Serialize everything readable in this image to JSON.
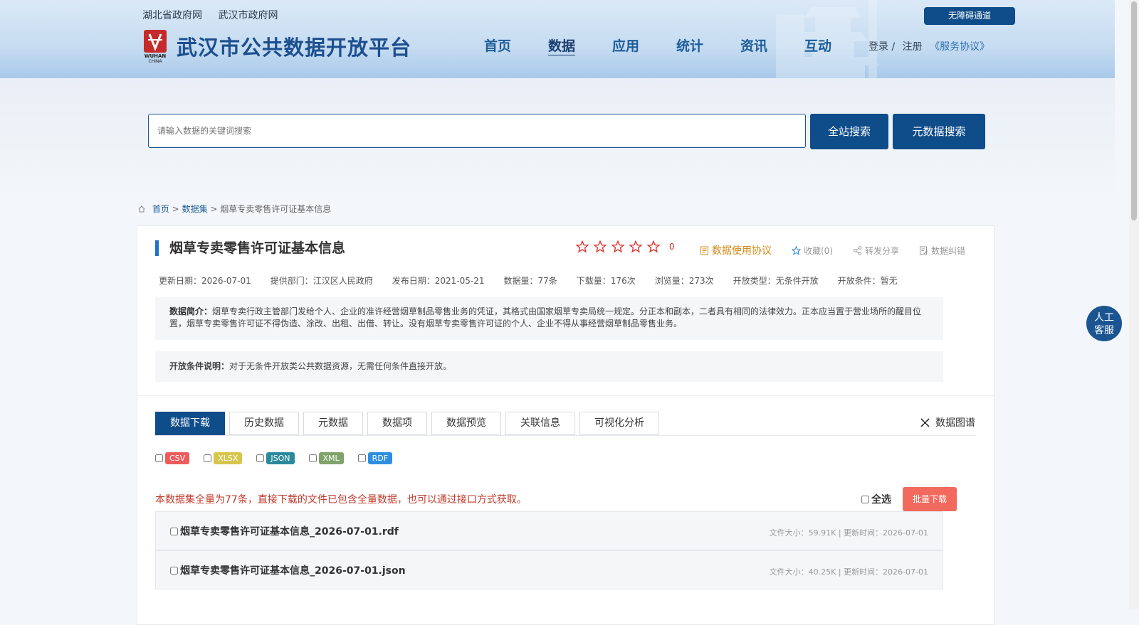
{
  "header": {
    "top_links": [
      "湖北省政府网",
      "武汉市政府网"
    ],
    "site_title": "武汉市公共数据开放平台",
    "nav": [
      "首页",
      "数据",
      "应用",
      "统计",
      "资讯",
      "互动"
    ],
    "nav_active": "数据",
    "accessibility_label": "无障碍通道",
    "login": "登录 /",
    "register": "注册",
    "service_agreement": "《服务协议》"
  },
  "search": {
    "placeholder": "请输入数据的关键词搜索",
    "site_search_label": "全站搜索",
    "metadata_search_label": "元数据搜索"
  },
  "breadcrumb": {
    "home": "首页",
    "separator": ">",
    "datasets": "数据集",
    "current": "烟草专卖零售许可证基本信息"
  },
  "dataset": {
    "title": "烟草专卖零售许可证基本信息",
    "rating_count": "0",
    "rating_stars": 5,
    "actions": {
      "usage_agreement": "数据使用协议",
      "favorite": "收藏(0)",
      "share": "转发分享",
      "report": "数据纠错"
    },
    "meta": [
      "更新日期：2026-07-01",
      "提供部门：江汉区人民政府",
      "发布日期：2021-05-21",
      "数据量：77条",
      "下载量：176次",
      "浏览量：273次",
      "开放类型：无条件开放",
      "开放条件：暂无"
    ],
    "desc_label": "数据简介：",
    "desc_text": "烟草专卖行政主管部门发给个人、企业的准许经营烟草制品零售业务的凭证，其格式由国家烟草专卖局统一规定。分正本和副本，二者具有相同的法律效力。正本应当置于营业场所的醒目位置，烟草专卖零售许可证不得伪造、涂改、出租、出借、转让。没有烟草专卖零售许可证的个人、企业不得从事经营烟草制品零售业务。",
    "cond_label": "开放条件说明：",
    "cond_text": "对于无条件开放类公共数据资源，无需任何条件直接开放。"
  },
  "tabs": [
    "数据下载",
    "历史数据",
    "元数据",
    "数据项",
    "数据预览",
    "关联信息",
    "可视化分析"
  ],
  "active_tab": "数据下载",
  "graph_link": "数据图谱",
  "formats": [
    {
      "label": "CSV",
      "color": "#ef5b5b"
    },
    {
      "label": "XLSX",
      "color": "#d8c54e"
    },
    {
      "label": "JSON",
      "color": "#2a8a9c"
    },
    {
      "label": "XML",
      "color": "#7fa46b"
    },
    {
      "label": "RDF",
      "color": "#2e8ee0"
    }
  ],
  "notice": "本数据集全量为77条，直接下载的文件已包含全量数据，也可以通过接口方式获取。",
  "select_all": "全选",
  "batch_download": "批量下载",
  "files": [
    {
      "name": "烟草专卖零售许可证基本信息_2026-07-01.rdf",
      "meta": "文件大小：59.91K | 更新时间：2026-07-01"
    },
    {
      "name": "烟草专卖零售许可证基本信息_2026-07-01.json",
      "meta": "文件大小：40.25K | 更新时间：2026-07-01"
    }
  ],
  "service": {
    "line1": "人工",
    "line2": "客服"
  },
  "colors": {
    "primary": "#0f4c8a",
    "accent_red": "#f26a5d",
    "notice_red": "#c0392b",
    "agree_orange": "#d38a16"
  }
}
